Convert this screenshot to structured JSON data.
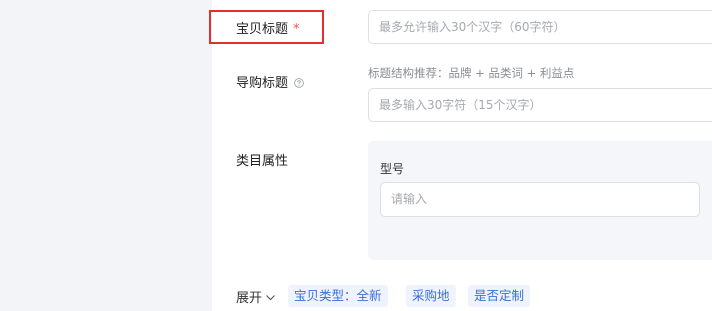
{
  "form": {
    "title_field": {
      "label": "宝贝标题",
      "required_mark": "*",
      "placeholder": "最多允许输入30个汉字（60字符）"
    },
    "guide_title_field": {
      "label": "导购标题",
      "help_icon": "question-circle-icon",
      "hint": "标题结构推荐：品牌 + 品类词 + 利益点",
      "placeholder": "最多输入30字符（15个汉字）"
    },
    "category_attributes": {
      "label": "类目属性",
      "model_field": {
        "label": "型号",
        "placeholder": "请输入"
      }
    },
    "expand": {
      "label": "展开",
      "icon": "chevron-down-icon",
      "tags": [
        "宝贝类型：全新",
        "采购地",
        "是否定制"
      ]
    }
  },
  "colors": {
    "highlight_border": "#e0302d",
    "required_star": "#ff4d4f",
    "tag_text": "#3a6fd8",
    "tag_background": "#eef3fd",
    "side_background": "#f3f4f7",
    "panel_background": "#f5f6f9"
  }
}
